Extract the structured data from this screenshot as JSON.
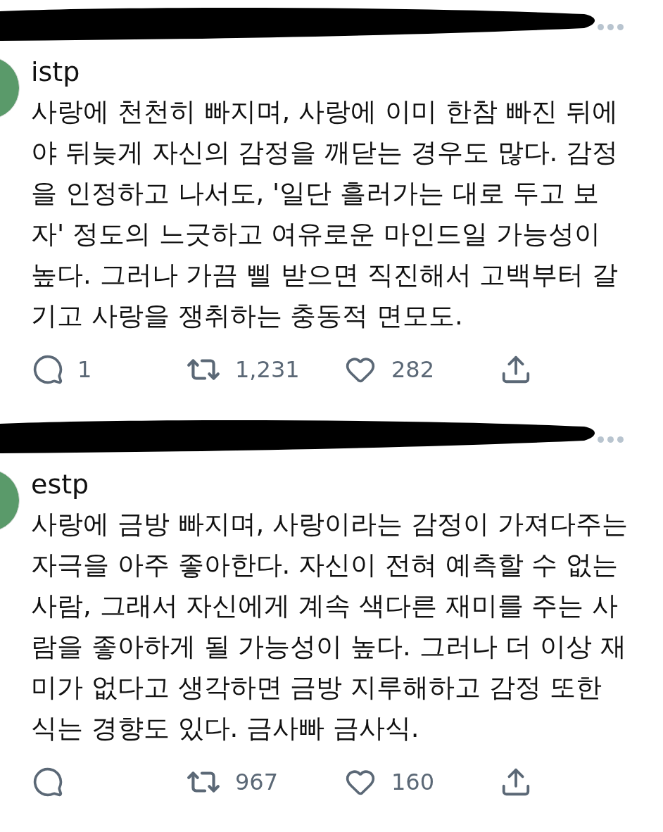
{
  "tweets": [
    {
      "label": "istp",
      "text": "사랑에 천천히 빠지며, 사랑에 이미 한참 빠진 뒤에야 뒤늦게 자신의 감정을 깨닫는 경우도 많다. 감정을 인정하고 나서도, '일단 흘러가는 대로 두고 보자' 정도의 느긋하고 여유로운 마인드일 가능성이 높다. 그러나 가끔 삘 받으면 직진해서 고백부터 갈기고 사랑을 쟁취하는 충동적 면모도.",
      "replies": "1",
      "retweets": "1,231",
      "likes": "282"
    },
    {
      "label": "estp",
      "text": "사랑에 금방 빠지며, 사랑이라는 감정이 가져다주는 자극을 아주 좋아한다. 자신이 전혀 예측할 수 없는 사람, 그래서 자신에게 계속 색다른 재미를 주는 사람을 좋아하게 될 가능성이 높다. 그러나 더 이상 재미가 없다고 생각하면 금방 지루해하고 감정 또한 식는 경향도 있다. 금사빠 금사식.",
      "retweets": "967",
      "likes": "160"
    }
  ]
}
